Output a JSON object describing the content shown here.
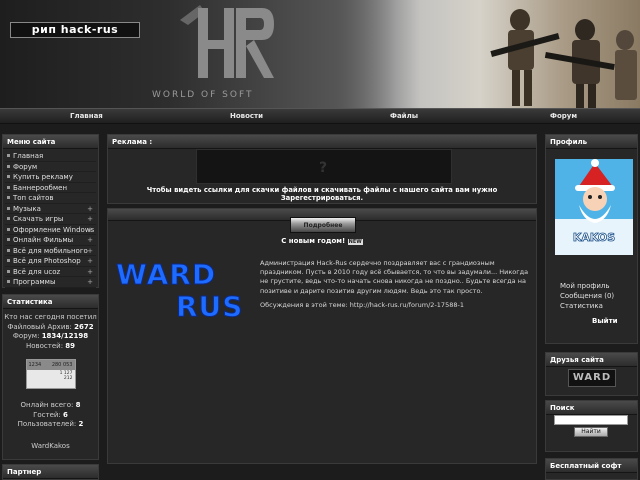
{
  "header": {
    "site_logo": "рип hack-rus",
    "brand_tagline": "WORLD OF SOFT"
  },
  "nav": {
    "items": [
      "Главная",
      "Новости",
      "Файлы",
      "Форум"
    ]
  },
  "left": {
    "menu": {
      "title": "Меню сайта",
      "items": [
        {
          "label": "Главная",
          "expandable": false
        },
        {
          "label": "Форум",
          "expandable": false
        },
        {
          "label": "Купить рекламу",
          "expandable": false
        },
        {
          "label": "Баннерообмен",
          "expandable": false
        },
        {
          "label": "Топ сайтов",
          "expandable": false
        },
        {
          "label": "Музыка",
          "expandable": true
        },
        {
          "label": "Скачать игры",
          "expandable": true
        },
        {
          "label": "Оформление Windows",
          "expandable": true
        },
        {
          "label": "Онлайн Фильмы",
          "expandable": true
        },
        {
          "label": "Всё для мобильного",
          "expandable": true
        },
        {
          "label": "Всё для Photoshop",
          "expandable": true
        },
        {
          "label": "Всё для ucoz",
          "expandable": true
        },
        {
          "label": "Программы",
          "expandable": true
        }
      ],
      "plus_symbol": "+"
    },
    "stats": {
      "title": "Статистика",
      "visits_today_label": "Кто нас сегодня посетил",
      "files_label": "Файловый Архив:",
      "files_value": "2672",
      "forum_label": "Форум:",
      "forum_value": "1834/12198",
      "news_label": "Новостей:",
      "news_value": "89",
      "counter_top_left": "1234",
      "counter_row1": [
        "",
        "280 053"
      ],
      "counter_row2": [
        "",
        "1 127"
      ],
      "counter_row3": [
        "",
        "212"
      ],
      "online_label": "Онлайн всего:",
      "online_value": "8",
      "guests_label": "Гостей:",
      "guests_value": "6",
      "users_label": "Пользователей:",
      "users_value": "2",
      "online_user": "WardKakos"
    },
    "partner": {
      "title": "Партнер"
    }
  },
  "center": {
    "ad": {
      "title": "Реклама :",
      "placeholder_symbol": "?",
      "register_note": "Чтобы видеть ссылки для скачки файлов и скачивать файлы с нашего сайта вам нужно Зарегестрироваться."
    },
    "news": {
      "button_label": "Подробнее",
      "title": "С новым годом!",
      "title_tag": "NEW",
      "logo_top": "WARD",
      "logo_bottom": "RUS",
      "paragraph1": "Администрация Hack-Rus сердечно поздравляет вас с грандиозным праздником. Пусть в 2010 году всё сбывается, то что вы задумали... Никогда не грустите, ведь что-то начать снова никогда не поздно.. Будьте всегда на позитиве и дарите позитив другим людям. Ведь это так просто.",
      "paragraph2": "Обсуждения в этой теме: http://hack-rus.ru/forum/2-17588-1"
    }
  },
  "right": {
    "profile": {
      "title": "Профиль",
      "avatar_caption": "KAKOS",
      "links": [
        "Мой профиль",
        "Сообщения (0)",
        "Статистика"
      ],
      "exit_label": "Выйти"
    },
    "friends": {
      "title": "Друзья сайта",
      "banner_text": "WARD"
    },
    "search": {
      "title": "Поиск",
      "input_value": "",
      "button_label": "Найти"
    },
    "free_soft": {
      "title": "Бесплатный софт"
    }
  },
  "colors": {
    "background": "#1c1c1c",
    "panel": "#272727",
    "ward_blue": "#1e6bff"
  }
}
